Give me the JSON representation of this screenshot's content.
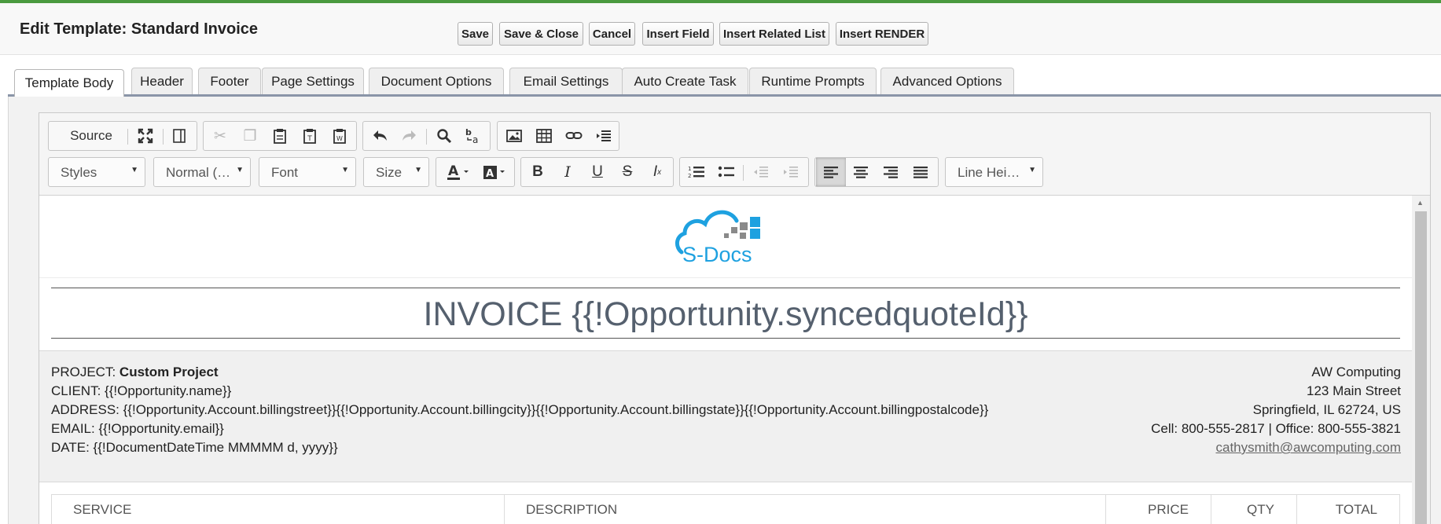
{
  "window": {
    "title": "Edit Template: Standard Invoice"
  },
  "actions": [
    {
      "name": "save-button",
      "label": "Save"
    },
    {
      "name": "save-close-button",
      "label": "Save & Close"
    },
    {
      "name": "cancel-button",
      "label": "Cancel"
    },
    {
      "name": "insert-field-button",
      "label": "Insert Field"
    },
    {
      "name": "insert-related-list-button",
      "label": "Insert Related List"
    },
    {
      "name": "insert-render-button",
      "label": "Insert RENDER"
    }
  ],
  "tabs": [
    {
      "label": "Template Body",
      "active": true
    },
    {
      "label": "Header"
    },
    {
      "label": "Footer"
    },
    {
      "label": "Page Settings"
    },
    {
      "label": "Document Options"
    },
    {
      "label": "Email Settings"
    },
    {
      "label": "Auto Create Task"
    },
    {
      "label": "Runtime Prompts"
    },
    {
      "label": "Advanced Options"
    }
  ],
  "toolbar": {
    "source_label": "Source",
    "styles_label": "Styles",
    "format_label": "Normal (…",
    "font_label": "Font",
    "size_label": "Size",
    "lineheight_label": "Line Hei…",
    "icons": [
      "maximize-icon",
      "show-blocks-icon",
      "cut-icon",
      "copy-icon",
      "paste-icon",
      "paste-text-icon",
      "paste-word-icon",
      "undo-icon",
      "redo-icon",
      "find-icon",
      "replace-icon",
      "image-icon",
      "table-icon",
      "link-icon",
      "indent-insert-icon",
      "text-color-icon",
      "bg-color-icon",
      "bold-icon",
      "italic-icon",
      "underline-icon",
      "strike-icon",
      "remove-format-icon",
      "numbered-list-icon",
      "bullet-list-icon",
      "outdent-icon",
      "indent-icon",
      "align-left-icon",
      "align-center-icon",
      "align-right-icon",
      "justify-icon"
    ],
    "colors": {
      "toolbar_bg": "#f5f5f5",
      "active_align": "#d8d8d8"
    }
  },
  "document": {
    "logo_text": "S-Docs",
    "invoice_heading": "INVOICE {{!Opportunity.syncedquoteId}}",
    "project_label": "PROJECT:",
    "project_value": "Custom Project",
    "client_line": "CLIENT: {{!Opportunity.name}}",
    "address_line": "ADDRESS: {{!Opportunity.Account.billingstreet}}{{!Opportunity.Account.billingcity}}{{!Opportunity.Account.billingstate}}{{!Opportunity.Account.billingpostalcode}}",
    "email_line": "EMAIL: {{!Opportunity.email}}",
    "date_line": "DATE: {{!DocumentDateTime MMMMM d, yyyy}}",
    "company_name": "AW Computing",
    "company_street": "123 Main Street",
    "company_city": "Springfield, IL 62724, US",
    "company_phone": "Cell: 800-555-2817 | Office: 800-555-3821",
    "company_email": "cathysmith@awcomputing.com",
    "table_headers": [
      "SERVICE",
      "DESCRIPTION",
      "PRICE",
      "QTY",
      "TOTAL"
    ]
  },
  "colors": {
    "accent": "#4a9a3f",
    "tab_underline": "#8a95a8",
    "heading_text": "#55606e",
    "logo_blue": "#1ea1e0",
    "logo_gray": "#8a8a8a"
  }
}
